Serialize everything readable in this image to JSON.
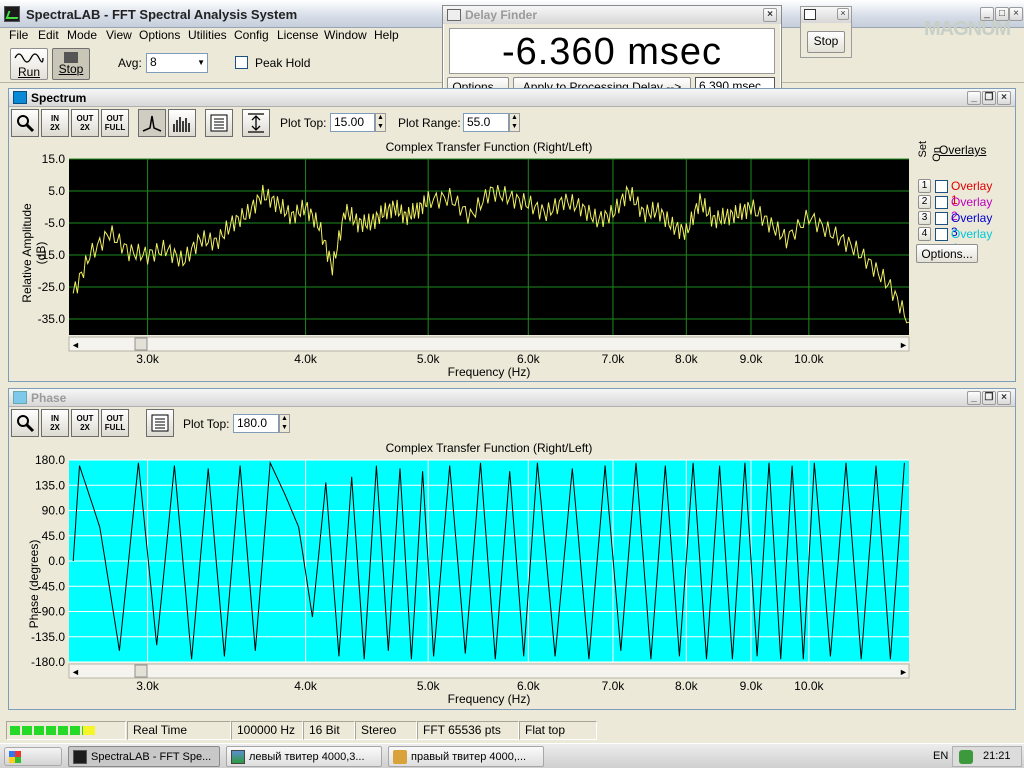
{
  "window": {
    "title": "SpectraLAB - FFT Spectral Analysis System"
  },
  "menu": [
    "File",
    "Edit",
    "Mode",
    "View",
    "Options",
    "Utilities",
    "Config",
    "License",
    "Window",
    "Help"
  ],
  "toolbar": {
    "run_label": "Run",
    "stop_label": "Stop",
    "avg_label": "Avg:",
    "avg_value": "8",
    "peak_hold_label": "Peak Hold"
  },
  "delay_finder": {
    "title": "Delay Finder",
    "value": "-6.360 msec",
    "options_label": "Options...",
    "apply_label": "Apply to Processing Delay -->",
    "delay_value": "6.390 msec"
  },
  "stop_window": {
    "stop_label": "Stop"
  },
  "logo": "MAGNUM",
  "spectrum": {
    "title": "Spectrum",
    "plot_top_label": "Plot Top:",
    "plot_top_value": "15.00",
    "plot_range_label": "Plot Range:",
    "plot_range_value": "55.0",
    "overlays_title": "Overlays",
    "set_label": "Set",
    "on_label": "On",
    "overlays": [
      {
        "num": "1",
        "label": "Overlay 1",
        "color": "#e00000"
      },
      {
        "num": "2",
        "label": "Overlay 2",
        "color": "#c000c0"
      },
      {
        "num": "3",
        "label": "Overlay 3",
        "color": "#0000d0"
      },
      {
        "num": "4",
        "label": "Overlay 4",
        "color": "#00c8d8"
      }
    ],
    "options_label": "Options..."
  },
  "phase": {
    "title": "Phase",
    "plot_top_label": "Plot Top:",
    "plot_top_value": "180.0"
  },
  "chart_data": [
    {
      "type": "line",
      "title": "Complex Transfer Function (Right/Left)",
      "xlabel": "Frequency (Hz)",
      "ylabel": "Relative Amplitude (dB)",
      "ylim": [
        -40,
        15
      ],
      "xlim_khz": [
        2.6,
        12.0
      ],
      "x_scale": "log",
      "yticks": [
        "15.0",
        "5.0",
        "-5.0",
        "-15.0",
        "-25.0",
        "-35.0"
      ],
      "xticks": [
        "3.0k",
        "4.0k",
        "5.0k",
        "6.0k",
        "7.0k",
        "8.0k",
        "9.0k",
        "10.0k"
      ],
      "colors": {
        "background": "#000000",
        "grid": "#1e8a1e",
        "trace": "#f0f060"
      },
      "series": [
        {
          "x": [
            2.62,
            2.7,
            2.8,
            2.9,
            3.0,
            3.1,
            3.2,
            3.3,
            3.4,
            3.5,
            3.6,
            3.7,
            3.8,
            3.9,
            4.0,
            4.1,
            4.2,
            4.3,
            4.4,
            4.5,
            4.6,
            4.7,
            4.8,
            4.9,
            5.0,
            5.2,
            5.4,
            5.6,
            5.8,
            6.0,
            6.2,
            6.4,
            6.6,
            6.8,
            7.0,
            7.2,
            7.4,
            7.6,
            7.8,
            8.0,
            8.2,
            8.4,
            8.6,
            8.8,
            9.0,
            9.3,
            9.6,
            10.0,
            10.4,
            10.8,
            11.2,
            11.6,
            12.0
          ],
          "values": [
            -27,
            -15,
            -8,
            -14,
            -15,
            -13,
            -17,
            -10,
            -11,
            -5,
            -2,
            4,
            1,
            -3,
            0,
            -6,
            -19,
            -1,
            -5,
            -5,
            -2,
            0,
            -3,
            -1,
            2,
            3,
            -3,
            5,
            3,
            1,
            -2,
            2,
            0,
            -4,
            -2,
            5,
            -2,
            -1,
            -6,
            -8,
            2,
            -4,
            -3,
            -2,
            0,
            -5,
            -10,
            -3,
            -8,
            -12,
            -18,
            -25,
            -36
          ]
        }
      ]
    },
    {
      "type": "line",
      "title": "Complex Transfer Function (Right/Left)",
      "xlabel": "Frequency (Hz)",
      "ylabel": "Phase (degrees)",
      "ylim": [
        -180,
        180
      ],
      "xlim_khz": [
        2.6,
        12.0
      ],
      "x_scale": "log",
      "yticks": [
        "180.0",
        "135.0",
        "90.0",
        "45.0",
        "0.0",
        "-45.0",
        "-90.0",
        "-135.0",
        "-180.0"
      ],
      "xticks": [
        "3.0k",
        "4.0k",
        "5.0k",
        "6.0k",
        "7.0k",
        "8.0k",
        "9.0k",
        "10.0k"
      ],
      "colors": {
        "background": "#00ffff",
        "grid": "#ffffff",
        "trace": "#000000"
      },
      "series": [
        {
          "x": [
            2.62,
            2.65,
            2.75,
            2.85,
            2.95,
            3.05,
            3.15,
            3.25,
            3.35,
            3.45,
            3.55,
            3.65,
            3.75,
            3.85,
            3.95,
            4.05,
            4.15,
            4.25,
            4.35,
            4.45,
            4.55,
            4.65,
            4.75,
            4.85,
            4.95,
            5.05,
            5.2,
            5.35,
            5.5,
            5.65,
            5.8,
            5.95,
            6.1,
            6.3,
            6.5,
            6.7,
            6.9,
            7.1,
            7.3,
            7.5,
            7.7,
            7.9,
            8.1,
            8.3,
            8.5,
            8.7,
            8.9,
            9.1,
            9.3,
            9.5,
            9.7,
            9.9,
            10.1,
            10.4,
            10.7,
            11.0,
            11.3,
            11.6,
            11.9
          ],
          "values": [
            0,
            170,
            60,
            -160,
            175,
            -150,
            170,
            -175,
            165,
            -170,
            170,
            -160,
            175,
            120,
            60,
            -100,
            140,
            -170,
            150,
            -175,
            170,
            -160,
            165,
            -175,
            160,
            -170,
            170,
            -165,
            175,
            -175,
            160,
            -170,
            175,
            -170,
            165,
            -175,
            170,
            -160,
            175,
            -175,
            170,
            -170,
            175,
            -175,
            170,
            -175,
            175,
            -170,
            175,
            -175,
            170,
            -175,
            175,
            -170,
            175,
            -175,
            170,
            -175,
            175
          ]
        }
      ]
    }
  ],
  "status": {
    "mode": "Real Time",
    "rate": "100000 Hz",
    "bits": "16 Bit",
    "channels": "Stereo",
    "fft": "FFT 65536 pts",
    "window": "Flat top"
  },
  "taskbar": {
    "items": [
      "SpectraLAB - FFT Spe...",
      "левый твитер 4000,3...",
      "правый твитер 4000,..."
    ],
    "lang": "EN",
    "clock": "21:21"
  }
}
